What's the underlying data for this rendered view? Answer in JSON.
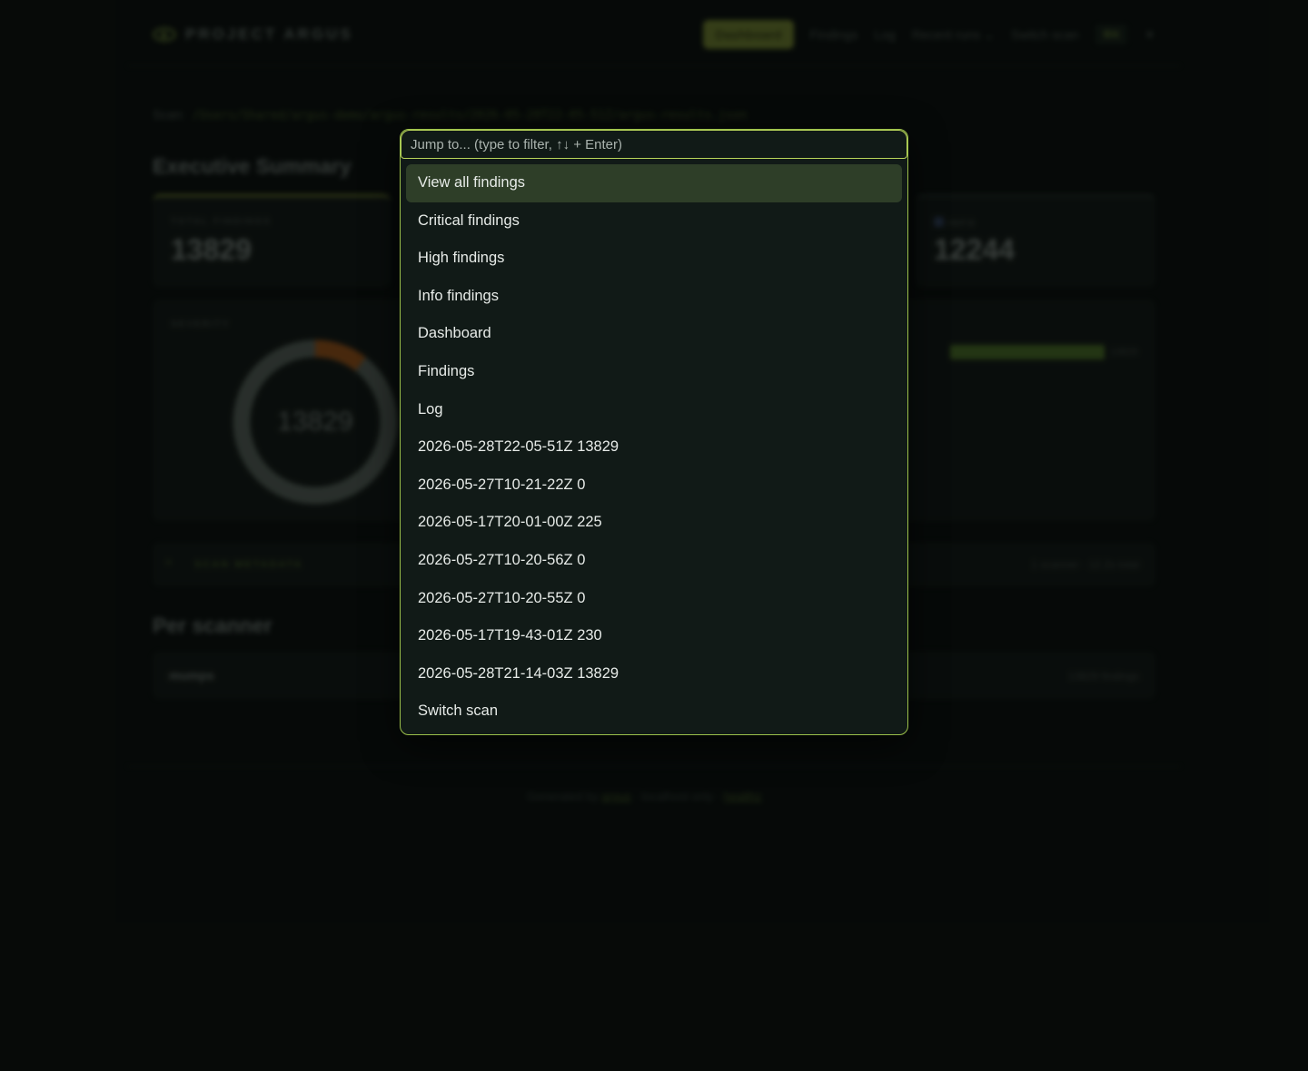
{
  "nav": {
    "brand": "PROJECT ARGUS",
    "links": [
      "Dashboard",
      "Findings",
      "Log",
      "Recent runs",
      "Switch scan"
    ],
    "shortcut": "⌘K",
    "theme_icon": "sun-icon"
  },
  "scan": {
    "label": "Scan:",
    "path": "/Users/Shared/argus-demo/argus-results/2026-05-28T22-05-51Z/argus-results.json"
  },
  "summary": {
    "title": "Executive Summary",
    "total_label": "TOTAL FINDINGS",
    "total_value": "13829",
    "info_label": "INFO",
    "info_value": "12244",
    "severity_label": "SEVERITY",
    "donut_center": "13829",
    "bar_value": "13829",
    "metadata_label": "SCAN METADATA",
    "metadata_right": "1 scanner · 12.2s total"
  },
  "per_scanner": {
    "title": "Per scanner",
    "name": "mumps",
    "findings": "13829 findings"
  },
  "footer": {
    "prefix": "Generated by",
    "link": "argus",
    "middle": "· localhost only ·",
    "health": "healthz"
  },
  "palette": {
    "placeholder": "Jump to... (type to filter, ↑↓ + Enter)",
    "items": [
      "View all findings",
      "Critical findings",
      "High findings",
      "Info findings",
      "Dashboard",
      "Findings",
      "Log",
      "2026-05-28T22-05-51Z 13829",
      "2026-05-27T10-21-22Z 0",
      "2026-05-17T20-01-00Z 225",
      "2026-05-27T10-20-56Z 0",
      "2026-05-27T10-20-55Z 0",
      "2026-05-17T19-43-01Z 230",
      "2026-05-28T21-14-03Z 13829",
      "Switch scan"
    ],
    "selected_index": 0
  },
  "colors": {
    "accent": "#9bc04a",
    "selected_bg": "#2e3e28",
    "palette_bg": "#111a17",
    "donut_main": "#6b786f",
    "donut_high": "#c0661c"
  }
}
